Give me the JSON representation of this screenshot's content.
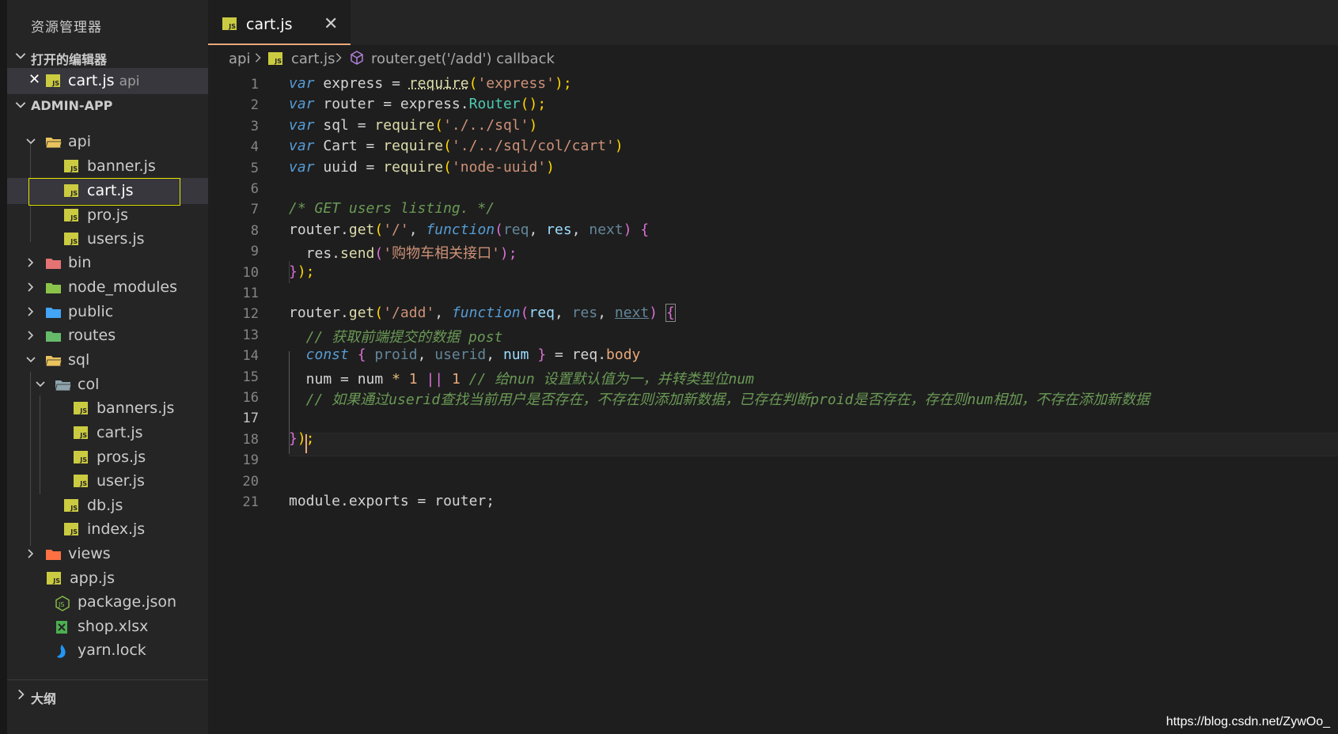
{
  "sidebar": {
    "title": "资源管理器",
    "open_editors": {
      "header": "打开的编辑器",
      "item_name": "cart.js",
      "item_desc": "api",
      "close_glyph": "✕"
    },
    "project": {
      "header": "ADMIN-APP",
      "items": [
        {
          "label": "api",
          "icon": "folder-open-icon"
        },
        {
          "label": "banner.js",
          "icon": "js-file-icon"
        },
        {
          "label": "cart.js",
          "icon": "js-file-icon"
        },
        {
          "label": "pro.js",
          "icon": "js-file-icon"
        },
        {
          "label": "users.js",
          "icon": "js-file-icon"
        },
        {
          "label": "bin",
          "icon": "folder-icon"
        },
        {
          "label": "node_modules",
          "icon": "folder-icon"
        },
        {
          "label": "public",
          "icon": "folder-icon"
        },
        {
          "label": "routes",
          "icon": "folder-icon"
        },
        {
          "label": "sql",
          "icon": "folder-open-icon"
        },
        {
          "label": "col",
          "icon": "folder-open-icon"
        },
        {
          "label": "banners.js",
          "icon": "js-file-icon"
        },
        {
          "label": "cart.js",
          "icon": "js-file-icon"
        },
        {
          "label": "pros.js",
          "icon": "js-file-icon"
        },
        {
          "label": "user.js",
          "icon": "js-file-icon"
        },
        {
          "label": "db.js",
          "icon": "js-file-icon"
        },
        {
          "label": "index.js",
          "icon": "js-file-icon"
        },
        {
          "label": "views",
          "icon": "folder-icon"
        },
        {
          "label": "app.js",
          "icon": "js-file-icon"
        },
        {
          "label": "package.json",
          "icon": "node-icon"
        },
        {
          "label": "shop.xlsx",
          "icon": "excel-icon"
        },
        {
          "label": "yarn.lock",
          "icon": "yarn-icon"
        }
      ]
    },
    "outline": {
      "header": "大纲"
    }
  },
  "tab": {
    "label": "cart.js",
    "close_glyph": "✕"
  },
  "breadcrumb": {
    "folder": "api",
    "file": "cart.js",
    "symbol": "router.get('/add') callback"
  },
  "line_numbers": [
    "1",
    "2",
    "3",
    "4",
    "5",
    "6",
    "7",
    "8",
    "9",
    "10",
    "11",
    "12",
    "13",
    "14",
    "15",
    "16",
    "17",
    "18",
    "19",
    "20",
    "21"
  ],
  "code": {
    "l1": {
      "kw": "var",
      "name": " express ",
      "eq": "= ",
      "fn": "require",
      "o": "(",
      "s": "'express'",
      "c": ");"
    },
    "l2": {
      "kw": "var",
      "name": " router ",
      "eq": "= ",
      "obj": "express.",
      "cls": "Router",
      "c": "();"
    },
    "l3": {
      "kw": "var",
      "name": " sql ",
      "eq": "= ",
      "fn": "require",
      "o": "(",
      "s": "'./../sql'",
      "c": ")"
    },
    "l4": {
      "kw": "var",
      "name": " Cart ",
      "eq": "= ",
      "fn": "require",
      "o": "(",
      "s": "'./../sql/col/cart'",
      "c": ")"
    },
    "l5": {
      "kw": "var",
      "name": " uuid ",
      "eq": "= ",
      "fn": "require",
      "o": "(",
      "s": "'node-uuid'",
      "c": ")"
    },
    "l7": {
      "com": "/* GET users listing. */"
    },
    "l8": {
      "obj": "router.",
      "fn": "get",
      "o": "(",
      "s": "'/'",
      "comma": ", ",
      "kw": "function",
      "o2": "(",
      "p1": "req",
      "c1": ", ",
      "p2": "res",
      "c2": ", ",
      "p3": "next",
      "c3": ") ",
      "b": "{"
    },
    "l9": {
      "obj": "  res.",
      "fn": "send",
      "o": "(",
      "s": "'购物车相关接口'",
      "c": ");"
    },
    "l10": {
      "b": "}",
      "c": ");"
    },
    "l12": {
      "obj": "router.",
      "fn": "get",
      "o": "(",
      "s": "'/add'",
      "comma": ", ",
      "kw": "function",
      "o2": "(",
      "p1": "req",
      "c1": ", ",
      "p2": "res",
      "c2": ", ",
      "p3": "next",
      "c3": ") ",
      "b": "{"
    },
    "l13": {
      "com": "  // 获取前端提交的数据 post"
    },
    "l14": {
      "kw": "  const",
      "b1": " { ",
      "v1": "proid",
      "c1": ", ",
      "v2": "userid",
      "c2": ", ",
      "v3": "num",
      "b2": " } ",
      "eq": "= ",
      "obj": "req.",
      "prop": "body"
    },
    "l15": {
      "v": "  num ",
      "eq": "= ",
      "v2": "num ",
      "op": "* ",
      "n1": "1",
      "op2": " || ",
      "n2": "1",
      "com": " // 给nun 设置默认值为一，并转类型位num"
    },
    "l16": {
      "com": "  // 如果通过userid查找当前用户是否存在，不存在则添加新数据，已存在判断proid是否存在，存在则num相加，不存在添加新数据"
    },
    "l18": {
      "b": "}",
      "c": ");"
    },
    "l21": {
      "t": "module.exports = router;"
    }
  },
  "watermark": "https://blog.csdn.net/ZywOo_"
}
